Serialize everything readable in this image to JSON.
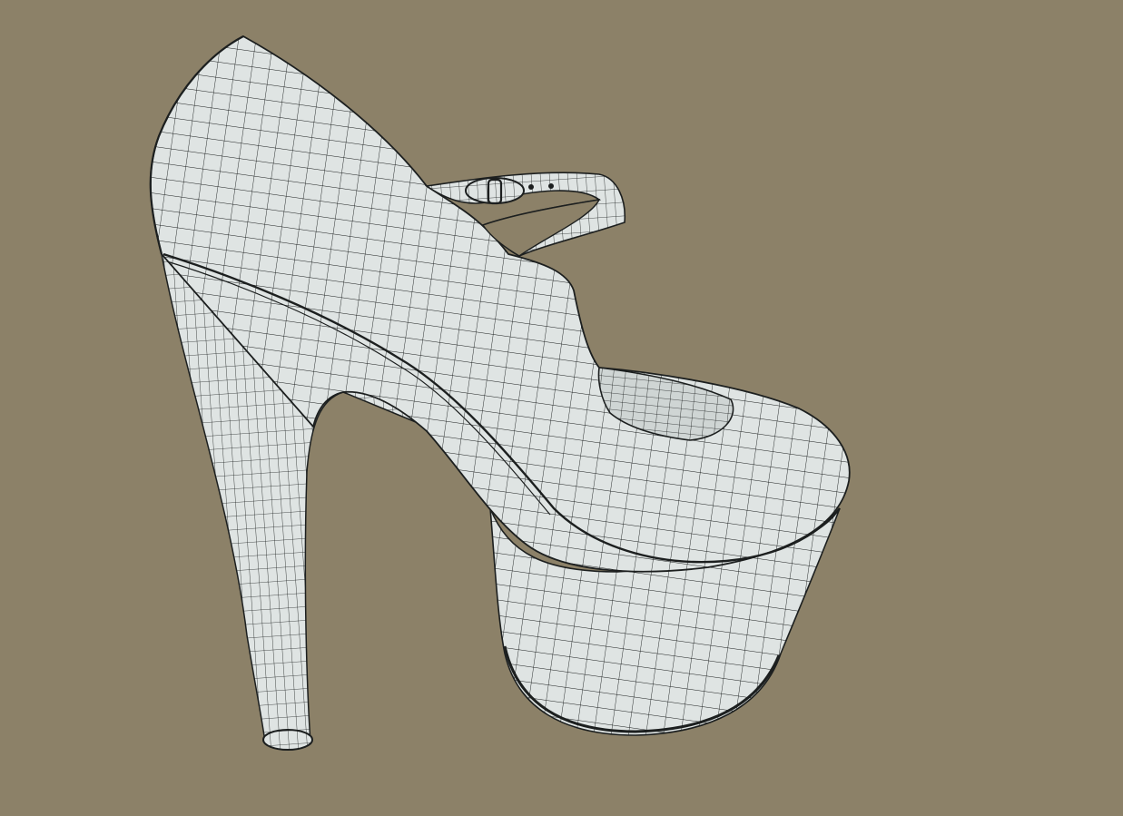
{
  "viewport": {
    "background_color": "#8c8168",
    "model": "high-heel-shoe-wireframe",
    "render_mode": "wireframe-on-shaded",
    "surface_color": "#dfe4e3",
    "wire_color": "#1c1f1f"
  }
}
